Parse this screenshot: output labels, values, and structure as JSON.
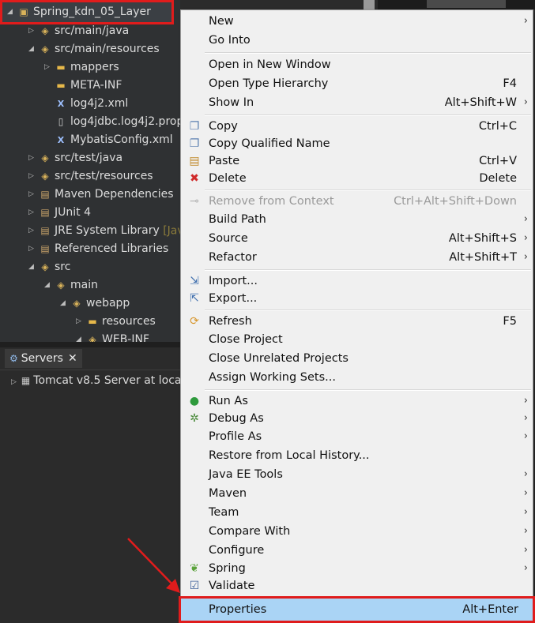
{
  "project_tree": {
    "root": {
      "label": "Spring_kdn_05_Layer"
    },
    "items": [
      {
        "label": "src/main/java",
        "icon": "package-folder-icon",
        "twisty": "closed"
      },
      {
        "label": "src/main/resources",
        "icon": "package-folder-icon",
        "twisty": "open"
      },
      {
        "label": "mappers",
        "icon": "folder-icon",
        "twisty": "closed"
      },
      {
        "label": "META-INF",
        "icon": "folder-icon",
        "twisty": "none"
      },
      {
        "label": "log4j2.xml",
        "icon": "xml-file-icon",
        "twisty": "none"
      },
      {
        "label": "log4jdbc.log4j2.prop",
        "icon": "file-icon",
        "twisty": "none"
      },
      {
        "label": "MybatisConfig.xml",
        "icon": "xml-file-icon",
        "twisty": "none"
      },
      {
        "label": "src/test/java",
        "icon": "package-folder-icon",
        "twisty": "closed"
      },
      {
        "label": "src/test/resources",
        "icon": "package-folder-icon",
        "twisty": "closed"
      },
      {
        "label": "Maven Dependencies",
        "icon": "library-icon",
        "twisty": "closed"
      },
      {
        "label": "JUnit 4",
        "icon": "library-icon",
        "twisty": "closed"
      },
      {
        "label": "JRE System Library",
        "decoration": "[Jav",
        "icon": "library-icon",
        "twisty": "closed"
      },
      {
        "label": "Referenced Libraries",
        "icon": "library-icon",
        "twisty": "closed"
      },
      {
        "label": "src",
        "icon": "source-folder-icon",
        "twisty": "open"
      },
      {
        "label": "main",
        "icon": "source-folder-icon",
        "twisty": "open"
      },
      {
        "label": "webapp",
        "icon": "source-folder-icon",
        "twisty": "open"
      },
      {
        "label": "resources",
        "icon": "folder-icon",
        "twisty": "closed"
      },
      {
        "label": "WEB-INF",
        "icon": "source-folder-icon",
        "twisty": "open"
      }
    ]
  },
  "servers_view": {
    "tab_label": "Servers",
    "server_row": "Tomcat v8.5 Server at loca"
  },
  "context_menu": {
    "items": [
      {
        "label": "New",
        "shortcut": "",
        "submenu": true
      },
      {
        "label": "Go Into",
        "shortcut": ""
      },
      {
        "label": "Open in New Window",
        "shortcut": ""
      },
      {
        "label": "Open Type Hierarchy",
        "shortcut": "F4"
      },
      {
        "label": "Show In",
        "shortcut": "Alt+Shift+W",
        "submenu": true
      },
      {
        "label": "Copy",
        "shortcut": "Ctrl+C",
        "icon": "copy-icon"
      },
      {
        "label": "Copy Qualified Name",
        "shortcut": "",
        "icon": "copy-qualified-icon"
      },
      {
        "label": "Paste",
        "shortcut": "Ctrl+V",
        "icon": "paste-icon"
      },
      {
        "label": "Delete",
        "shortcut": "Delete",
        "icon": "delete-icon"
      },
      {
        "label": "Remove from Context",
        "shortcut": "Ctrl+Alt+Shift+Down",
        "disabled": true,
        "icon": "remove-context-icon"
      },
      {
        "label": "Build Path",
        "shortcut": "",
        "submenu": true
      },
      {
        "label": "Source",
        "shortcut": "Alt+Shift+S",
        "submenu": true
      },
      {
        "label": "Refactor",
        "shortcut": "Alt+Shift+T",
        "submenu": true
      },
      {
        "label": "Import...",
        "shortcut": "",
        "icon": "import-icon"
      },
      {
        "label": "Export...",
        "shortcut": "",
        "icon": "export-icon"
      },
      {
        "label": "Refresh",
        "shortcut": "F5",
        "icon": "refresh-icon"
      },
      {
        "label": "Close Project",
        "shortcut": ""
      },
      {
        "label": "Close Unrelated Projects",
        "shortcut": ""
      },
      {
        "label": "Assign Working Sets...",
        "shortcut": ""
      },
      {
        "label": "Run As",
        "shortcut": "",
        "submenu": true,
        "icon": "run-icon"
      },
      {
        "label": "Debug As",
        "shortcut": "",
        "submenu": true,
        "icon": "debug-icon"
      },
      {
        "label": "Profile As",
        "shortcut": "",
        "submenu": true
      },
      {
        "label": "Restore from Local History...",
        "shortcut": ""
      },
      {
        "label": "Java EE Tools",
        "shortcut": "",
        "submenu": true
      },
      {
        "label": "Maven",
        "shortcut": "",
        "submenu": true
      },
      {
        "label": "Team",
        "shortcut": "",
        "submenu": true
      },
      {
        "label": "Compare With",
        "shortcut": "",
        "submenu": true
      },
      {
        "label": "Configure",
        "shortcut": "",
        "submenu": true
      },
      {
        "label": "Spring",
        "shortcut": "",
        "submenu": true,
        "icon": "spring-icon"
      },
      {
        "label": "Validate",
        "shortcut": "",
        "icon": "validate-check-icon"
      },
      {
        "label": "Properties",
        "shortcut": "Alt+Enter",
        "highlighted": true
      }
    ]
  },
  "colors": {
    "highlight_box": "#e01c1c",
    "selected_item_bg": "#aad4f5",
    "menu_bg": "#f0f0f0",
    "tree_bg": "#2f3133"
  }
}
